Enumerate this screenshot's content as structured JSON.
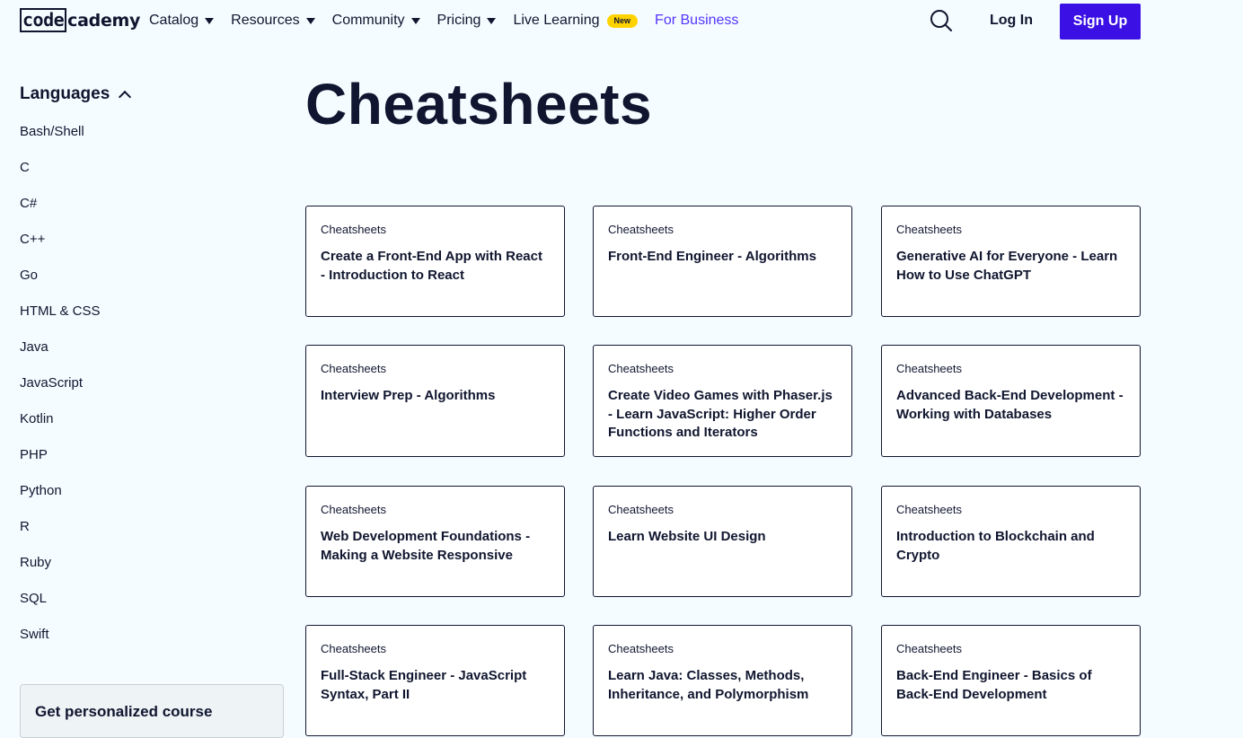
{
  "header": {
    "logo_left": "code",
    "logo_right": "cademy",
    "nav": [
      {
        "label": "Catalog",
        "dropdown": true
      },
      {
        "label": "Resources",
        "dropdown": true
      },
      {
        "label": "Community",
        "dropdown": true
      },
      {
        "label": "Pricing",
        "dropdown": true
      },
      {
        "label": "Live Learning",
        "dropdown": false,
        "badge": "New"
      },
      {
        "label": "For Business",
        "dropdown": false
      }
    ],
    "search_icon": "search-icon",
    "login_label": "Log In",
    "signup_label": "Sign Up",
    "accent_color": "#3a10e5",
    "business_color": "#5533ff",
    "badge_color": "#ffd300"
  },
  "sidebar": {
    "heading": "Languages",
    "items": [
      "Bash/Shell",
      "C",
      "C#",
      "C++",
      "Go",
      "HTML & CSS",
      "Java",
      "JavaScript",
      "Kotlin",
      "PHP",
      "Python",
      "R",
      "Ruby",
      "SQL",
      "Swift"
    ],
    "promo": "Get personalized course"
  },
  "main": {
    "title": "Cheatsheets",
    "cards": [
      {
        "kicker": "Cheatsheets",
        "title": "Create a Front-End App with React - Introduction to React"
      },
      {
        "kicker": "Cheatsheets",
        "title": "Front-End Engineer - Algorithms"
      },
      {
        "kicker": "Cheatsheets",
        "title": "Generative AI for Everyone - Learn How to Use ChatGPT"
      },
      {
        "kicker": "Cheatsheets",
        "title": "Interview Prep - Algorithms"
      },
      {
        "kicker": "Cheatsheets",
        "title": "Create Video Games with Phaser.js - Learn JavaScript: Higher Order Functions and Iterators"
      },
      {
        "kicker": "Cheatsheets",
        "title": "Advanced Back-End Development - Working with Databases"
      },
      {
        "kicker": "Cheatsheets",
        "title": "Web Development Foundations - Making a Website Responsive"
      },
      {
        "kicker": "Cheatsheets",
        "title": "Learn Website UI Design"
      },
      {
        "kicker": "Cheatsheets",
        "title": "Introduction to Blockchain and Crypto"
      },
      {
        "kicker": "Cheatsheets",
        "title": "Full-Stack Engineer - JavaScript Syntax, Part II"
      },
      {
        "kicker": "Cheatsheets",
        "title": "Learn Java: Classes, Methods, Inheritance, and Polymorphism"
      },
      {
        "kicker": "Cheatsheets",
        "title": "Back-End Engineer - Basics of Back-End Development"
      }
    ]
  }
}
